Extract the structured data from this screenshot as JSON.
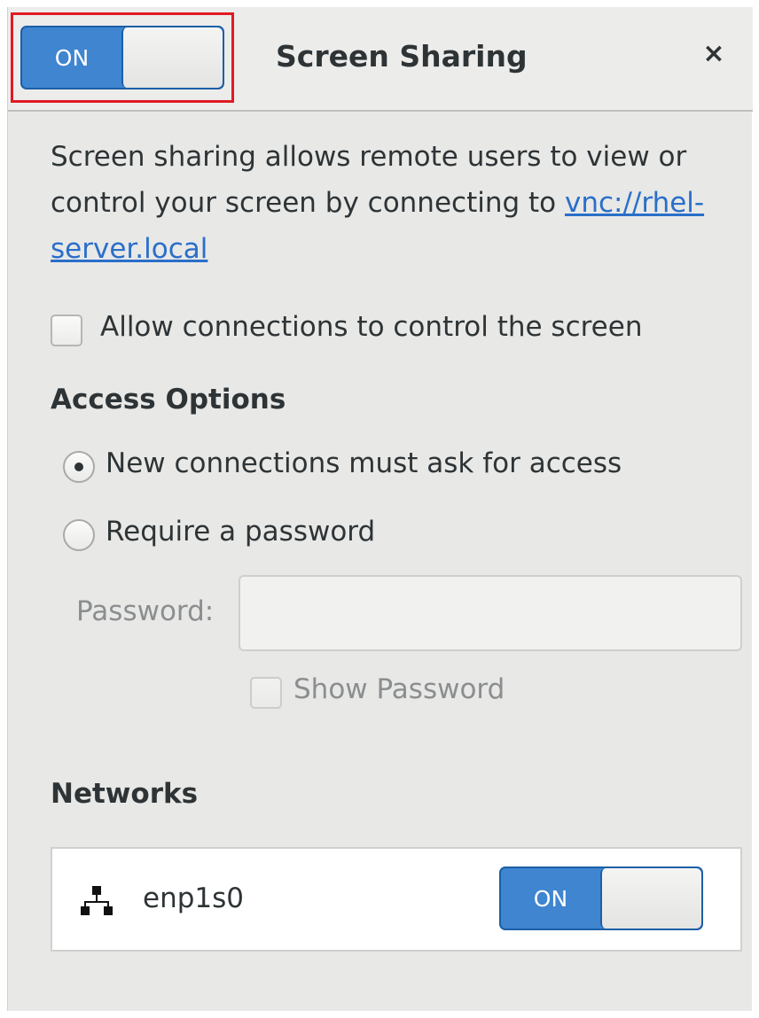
{
  "header": {
    "toggle_label": "ON",
    "toggle_on": true,
    "title": "Screen Sharing",
    "close_glyph": "×"
  },
  "description": {
    "text": "Screen sharing allows remote users to view or control your screen by connecting to ",
    "link_text": "vnc://rhel-server.local"
  },
  "allow_control": {
    "label": "Allow connections to control the screen",
    "checked": false
  },
  "access_options": {
    "heading": "Access Options",
    "options": [
      {
        "label": "New connections must ask for access",
        "selected": true
      },
      {
        "label": "Require a password",
        "selected": false
      }
    ],
    "password_label": "Password:",
    "password_value": "",
    "show_password_label": "Show Password"
  },
  "networks": {
    "heading": "Networks",
    "items": [
      {
        "name": "enp1s0",
        "icon": "network-wired-icon",
        "toggle_label": "ON",
        "toggle_on": true
      }
    ]
  },
  "colors": {
    "switch_on": "#3f85d0",
    "link": "#2a6fc9",
    "highlight": "#e01b24",
    "panel_bg": "#e8e8e7"
  }
}
